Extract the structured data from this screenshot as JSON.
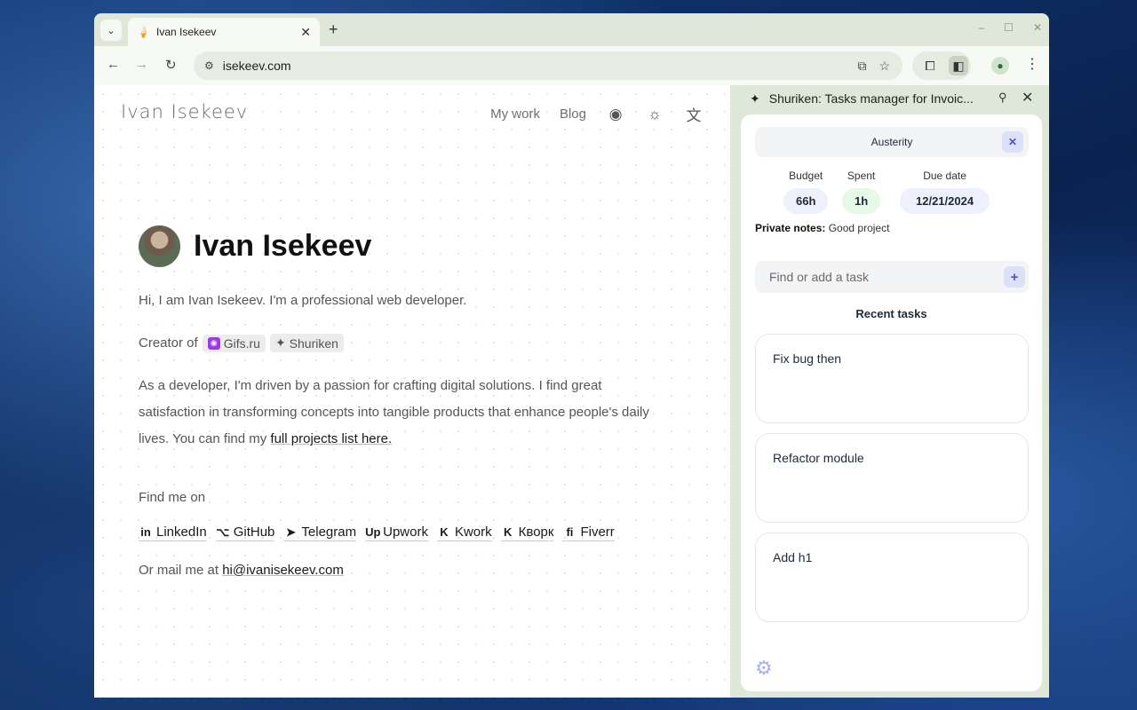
{
  "browser": {
    "tab_title": "Ivan Isekeev",
    "url": "isekeev.com",
    "window_controls": [
      "–",
      "☐",
      "✕"
    ]
  },
  "site": {
    "logo": "Ivan Isekeev",
    "nav": {
      "my_work": "My work",
      "blog": "Blog"
    },
    "name": "Ivan Isekeev",
    "intro": "Hi, I am Ivan Isekeev. I'm a professional web developer.",
    "creator_label": "Creator of",
    "creator_items": [
      "Gifs.ru",
      "Shuriken"
    ],
    "para_text": "As a developer, I'm driven by a passion for crafting digital solutions. I find great satisfaction in transforming concepts into tangible products that enhance people's daily lives. You can find my ",
    "para_link": "full projects list here.",
    "find_me": "Find me on",
    "socials": [
      {
        "label": "LinkedIn",
        "icon": "in"
      },
      {
        "label": "GitHub",
        "icon": "⌥"
      },
      {
        "label": "Telegram",
        "icon": "➤"
      },
      {
        "label": "Upwork",
        "icon": "Up"
      },
      {
        "label": "Kwork",
        "icon": "K"
      },
      {
        "label": "Кворк",
        "icon": "K"
      },
      {
        "label": "Fiverr",
        "icon": "fi"
      }
    ],
    "mail_label": "Or mail me at",
    "mail": "hi@ivanisekeev.com"
  },
  "sidepanel": {
    "title": "Shuriken: Tasks manager for Invoic...",
    "project": "Austerity",
    "budget_label": "Budget",
    "budget": "66h",
    "spent_label": "Spent",
    "spent": "1h",
    "due_label": "Due date",
    "due": "12/21/2024",
    "notes_label": "Private notes:",
    "notes": "Good project",
    "search_placeholder": "Find or add a task",
    "recent_title": "Recent tasks",
    "tasks": [
      "Fix bug then",
      "Refactor module",
      "Add h1"
    ],
    "colors": {
      "budget_pill": "#eef1fb",
      "spent_pill": "#e6f8e6",
      "due_pill": "#eef1fb",
      "accent": "#4b55c5"
    }
  }
}
